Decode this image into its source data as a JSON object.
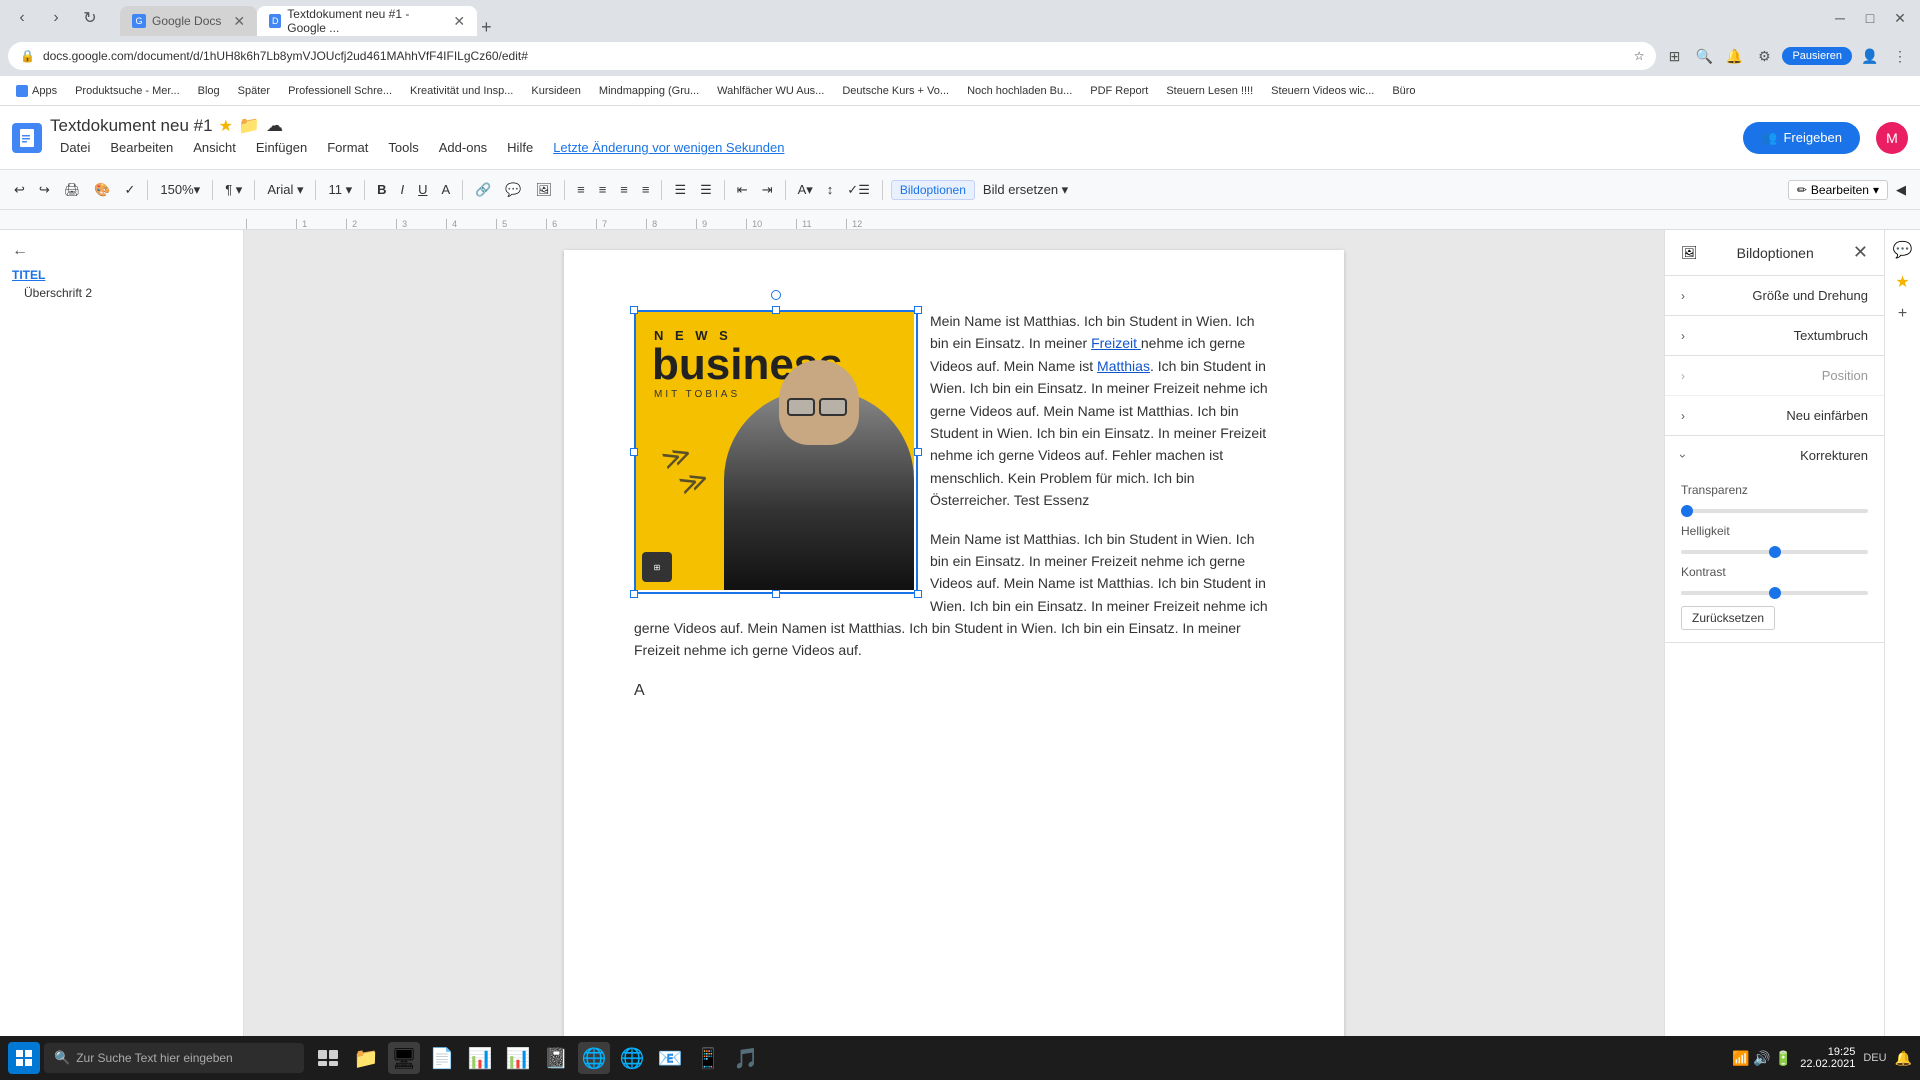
{
  "browser": {
    "tabs": [
      {
        "id": "tab1",
        "favicon": "G",
        "title": "Google Docs",
        "active": false
      },
      {
        "id": "tab2",
        "favicon": "D",
        "title": "Textdokument neu #1 - Google ...",
        "active": true
      }
    ],
    "url": "docs.google.com/document/d/1hUH8k6h7Lb8ymVJOUcfj2ud461MAhhVfF4IFILgCz60/edit#",
    "new_tab_label": "+"
  },
  "bookmarks": [
    {
      "label": "Apps"
    },
    {
      "label": "Produktsuche - Mer..."
    },
    {
      "label": "Blog"
    },
    {
      "label": "Später"
    },
    {
      "label": "Professionell Schre..."
    },
    {
      "label": "Kreativität und Insp..."
    },
    {
      "label": "Kursideen"
    },
    {
      "label": "Mindmapping (Gru..."
    },
    {
      "label": "Wahlfächer WU Aus..."
    },
    {
      "label": "Deutsche Kurs + Vo..."
    },
    {
      "label": "Noch hochladen Bu..."
    },
    {
      "label": "PDF Report"
    },
    {
      "label": "Steuern Lesen !!!!"
    },
    {
      "label": "Steuern Videos wic..."
    },
    {
      "label": "Büro"
    }
  ],
  "appbar": {
    "logo_char": "≡",
    "title": "Textdokument neu #1",
    "star": "★",
    "folder_icon": "📁",
    "cloud_icon": "☁",
    "menu_items": [
      "Datei",
      "Bearbeiten",
      "Ansicht",
      "Einfügen",
      "Format",
      "Tools",
      "Add-ons",
      "Hilfe"
    ],
    "last_edit": "Letzte Änderung vor wenigen Sekunden",
    "share_label": "Freigeben",
    "share_icon": "👥"
  },
  "toolbar": {
    "undo": "↩",
    "redo": "↪",
    "print": "🖨",
    "paint": "🎨",
    "spell": "✓",
    "zoom": "150%",
    "zoom_arrow": "▾",
    "format_btns": [
      "¶",
      "⊞",
      "🔗",
      "⊡",
      "⬜"
    ],
    "align_btns": [
      "≡",
      "≡",
      "≡",
      "≡"
    ],
    "list_btns": [
      "☰",
      "☰"
    ],
    "indent_btns": [
      "⇤",
      "⇥"
    ],
    "color_btn": "A",
    "line_spacing": "↕",
    "image_options_label": "Bildoptionen",
    "replace_image_label": "Bild ersetzen ▾",
    "edit_label": "Bearbeiten",
    "edit_arrow": "▾",
    "collapse": "◀"
  },
  "sidebar": {
    "back": "←",
    "title_label": "TITEL",
    "subtitle_label": "Überschrift 2"
  },
  "document": {
    "paragraph1": "Mein Name ist Matthias. Ich bin Student in Wien. Ich bin ein Einsatz. In meiner ",
    "link1": "Freizeit ",
    "paragraph1b": "nehme ich gerne Videos auf. Mein Name ist ",
    "link2": "Matthias",
    "paragraph1c": ". Ich bin Student in Wien. Ich bin ein Einsatz. In meiner Freizeit nehme ich gerne Videos auf. Mein Name ist Matthias. Ich bin Student in Wien. Ich bin ein Einsatz. In meiner Freizeit nehme ich gerne Videos auf. Fehler machen ist menschlich. Kein Problem für mich. Ich bin Österreicher. Test Essenz",
    "paragraph2": "Mein Name ist Matthias. Ich bin Student in Wien. Ich bin ein Einsatz. In meiner Freizeit nehme ich gerne Videos auf. Mein Name ist Matthias. Ich bin Student in Wien. Ich bin ein Einsatz. In meiner Freizeit nehme ich gerne Videos auf. Mein Namen ist Matthias. Ich bin Student in Wien. Ich bin ein Einsatz. In meiner Freizeit nehme ich gerne Videos auf.",
    "letter": "A",
    "news_title_top": "N E W S",
    "news_title_main": "business",
    "news_subtitle": "MIT TOBIAS"
  },
  "bild_panel": {
    "title": "Bildoptionen",
    "close": "✕",
    "sections": [
      {
        "id": "groesse",
        "label": "Größe und Drehung",
        "expanded": false,
        "arrow": "›"
      },
      {
        "id": "textumbruch",
        "label": "Textumbruch",
        "expanded": false,
        "arrow": "›"
      },
      {
        "id": "position",
        "label": "Position",
        "expanded": false,
        "arrow": "›",
        "disabled": true
      },
      {
        "id": "neu_einfaerben",
        "label": "Neu einfärben",
        "expanded": false,
        "arrow": "›"
      },
      {
        "id": "korrekturen",
        "label": "Korrekturen",
        "expanded": true,
        "arrow": "⌄"
      }
    ],
    "transparenz_label": "Transparenz",
    "helligkeit_label": "Helligkeit",
    "kontrast_label": "Kontrast",
    "reset_label": "Zurücksetzen",
    "transparenz_value": 0,
    "helligkeit_value": 50,
    "kontrast_value": 50
  },
  "taskbar": {
    "search_placeholder": "Zur Suche Text hier eingeben",
    "time": "19:25",
    "date": "22.02.2021",
    "language": "DEU",
    "apps": [
      "⊞",
      "📁",
      "🖥",
      "📄",
      "📊",
      "📊",
      "🎵",
      "🌐",
      "🌐",
      "📧",
      "📱",
      "🎵"
    ]
  }
}
